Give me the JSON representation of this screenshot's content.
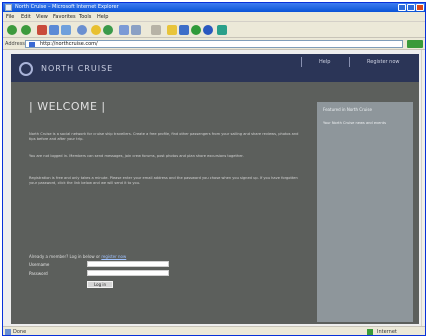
{
  "window": {
    "title": "North Cruise – Microsoft Internet Explorer"
  },
  "menu": [
    "File",
    "Edit",
    "View",
    "Favorites",
    "Tools",
    "Help"
  ],
  "address": {
    "label": "Address",
    "url": "http://northcruise.com/",
    "go_label": "Go"
  },
  "site": {
    "name": "NORTH CRUISE",
    "nav": [
      "Help",
      "Register now"
    ]
  },
  "main": {
    "welcome": "| WELCOME |",
    "paragraphs": [
      "North Cruise is a social network for cruise ship travellers. Create a free profile, find other passengers from your sailing and share reviews, photos and tips before and after your trip.",
      "You are not logged in. Members can send messages, join crew forums, post photos and plan shore excursions together.",
      "Registration is free and only takes a minute. Please enter your email address and the password you chose when you signed up. If you have forgotten your password, click the link below and we will send it to you."
    ],
    "login_prompt": "Already a member? Log in below or",
    "login_link": "register now",
    "username_label": "Username",
    "password_label": "Password",
    "login_button": "Log in"
  },
  "sidebar": {
    "title": "Featured in North Cruise",
    "text": "Your North Cruise news and events"
  },
  "status": {
    "text": "Done",
    "zone": "Internet"
  },
  "colors": {
    "header": "#2b3557",
    "page_bg": "#5c5f5c",
    "sidebar_bg": "#8e969b"
  }
}
